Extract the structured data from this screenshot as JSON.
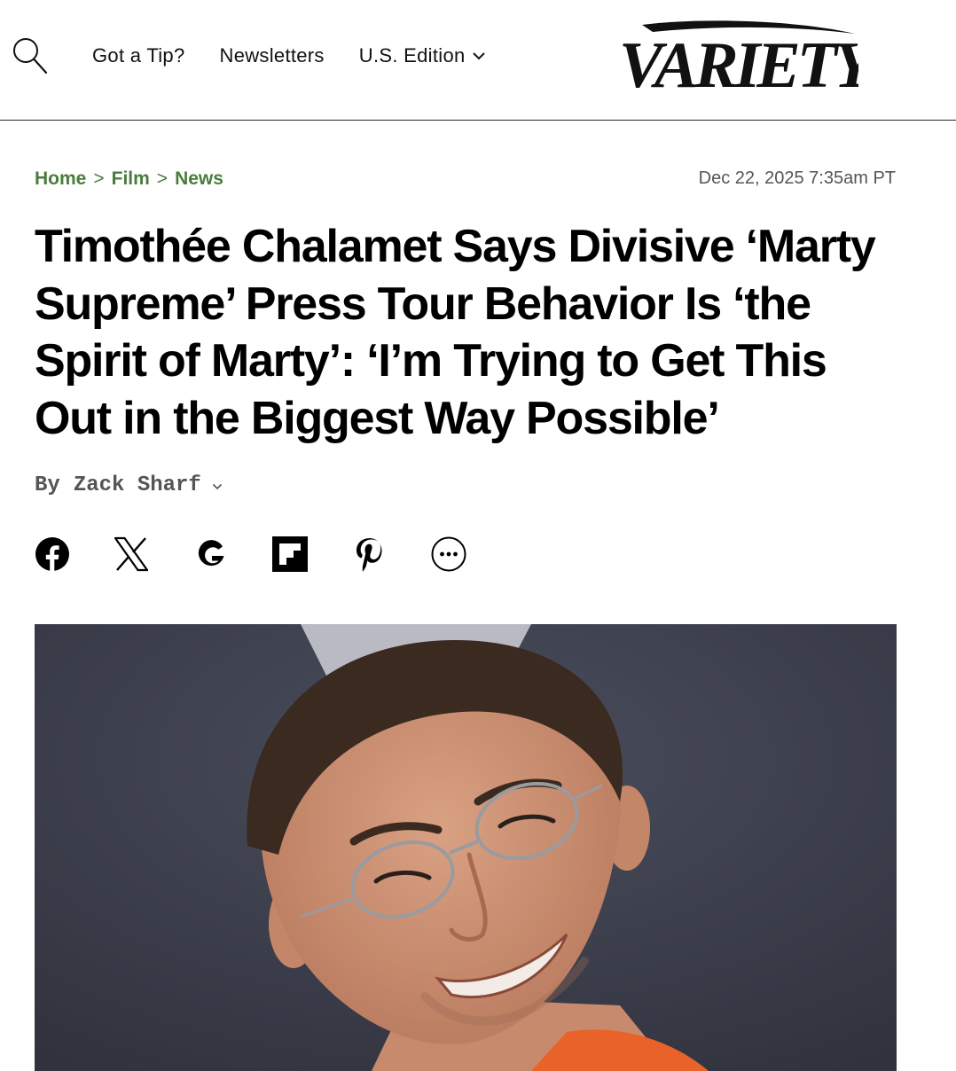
{
  "header": {
    "search_icon": "search-icon",
    "nav": {
      "tip": "Got a Tip?",
      "newsletters": "Newsletters",
      "edition": "U.S. Edition"
    },
    "logo_text": "VARIETY"
  },
  "breadcrumb": {
    "items": [
      "Home",
      "Film",
      "News"
    ],
    "separator": ">"
  },
  "date": "Dec 22, 2025 7:35am PT",
  "headline": "Timothée Chalamet Says Divisive ‘Marty Supreme’ Press Tour Behavior Is ‘the Spirit of Marty’: ‘I’m Trying to Get This Out in the Biggest Way Possible’",
  "byline": {
    "prefix": "By",
    "author": "Zack Sharf"
  },
  "social": [
    "facebook-icon",
    "x-icon",
    "google-icon",
    "flipboard-icon",
    "pinterest-icon",
    "more-icon"
  ],
  "colors": {
    "breadcrumb": "#4a7c3c",
    "text": "#000000",
    "muted": "#555555",
    "hero_background": "#3a3d4a"
  }
}
